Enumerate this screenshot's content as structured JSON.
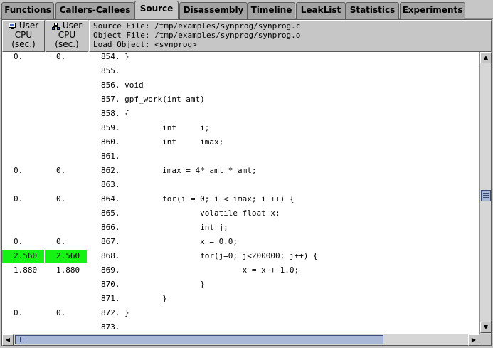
{
  "tabs": [
    {
      "label": "Functions"
    },
    {
      "label": "Callers-Callees"
    },
    {
      "label": "Source"
    },
    {
      "label": "Disassembly"
    },
    {
      "label": "Timeline"
    },
    {
      "label": "LeakList"
    },
    {
      "label": "Statistics"
    },
    {
      "label": "Experiments"
    }
  ],
  "active_tab": "Source",
  "columns": [
    {
      "line1": "User",
      "line2": "CPU",
      "line3": "(sec.)",
      "icon": "cpu-exclusive-icon"
    },
    {
      "line1": "User",
      "line2": "CPU",
      "line3": "(sec.)",
      "icon": "cpu-inclusive-icon"
    }
  ],
  "source_header": {
    "source_file": "Source File: /tmp/examples/synprog/synprog.c",
    "object_file": "Object File: /tmp/examples/synprog/synprog.o",
    "load_object": "Load Object: <synprog>"
  },
  "highlight_color": "#15f315",
  "rows": [
    {
      "m1": "0.",
      "m2": "0.",
      "code": "854. }",
      "hot": false
    },
    {
      "m1": "",
      "m2": "",
      "code": "855.",
      "hot": false
    },
    {
      "m1": "",
      "m2": "",
      "code": "856. void",
      "hot": false
    },
    {
      "m1": "",
      "m2": "",
      "code": "857. gpf_work(int amt)",
      "hot": false
    },
    {
      "m1": "",
      "m2": "",
      "code": "858. {",
      "hot": false
    },
    {
      "m1": "",
      "m2": "",
      "code": "859.         int     i;",
      "hot": false
    },
    {
      "m1": "",
      "m2": "",
      "code": "860.         int     imax;",
      "hot": false
    },
    {
      "m1": "",
      "m2": "",
      "code": "861.",
      "hot": false
    },
    {
      "m1": "0.",
      "m2": "0.",
      "code": "862.         imax = 4* amt * amt;",
      "hot": false
    },
    {
      "m1": "",
      "m2": "",
      "code": "863.",
      "hot": false
    },
    {
      "m1": "0.",
      "m2": "0.",
      "code": "864.         for(i = 0; i < imax; i ++) {",
      "hot": false
    },
    {
      "m1": "",
      "m2": "",
      "code": "865.                 volatile float x;",
      "hot": false
    },
    {
      "m1": "",
      "m2": "",
      "code": "866.                 int j;",
      "hot": false
    },
    {
      "m1": "0.",
      "m2": "0.",
      "code": "867.                 x = 0.0;",
      "hot": false
    },
    {
      "m1": "2.560",
      "m2": "2.560",
      "code": "868.                 for(j=0; j<200000; j++) {",
      "hot": true
    },
    {
      "m1": "1.880",
      "m2": "1.880",
      "code": "869.                          x = x + 1.0;",
      "hot": false
    },
    {
      "m1": "",
      "m2": "",
      "code": "870.                 }",
      "hot": false
    },
    {
      "m1": "",
      "m2": "",
      "code": "871.         }",
      "hot": false
    },
    {
      "m1": "0.",
      "m2": "0.",
      "code": "872. }",
      "hot": false
    },
    {
      "m1": "",
      "m2": "",
      "code": "873.",
      "hot": false
    }
  ],
  "scrollbar": {
    "vertical_position": 0.51,
    "horizontal_visible_fraction": 0.82
  },
  "icons": {
    "scroll_up": "▲",
    "scroll_down": "▼",
    "scroll_left": "◀",
    "scroll_right": "▶"
  }
}
